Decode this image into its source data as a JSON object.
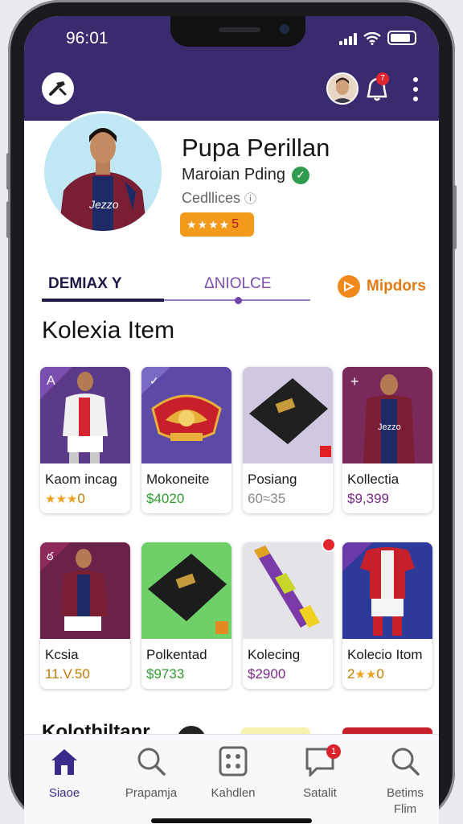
{
  "status_bar": {
    "time": "96:01"
  },
  "header": {
    "notification_count": "7"
  },
  "profile": {
    "name": "Pupa Perillan",
    "subtitle": "Maroian Pding",
    "meta": "Cedllices",
    "rating_stars": "★★★★",
    "rating_value": "5"
  },
  "tabs": [
    {
      "label": "DEMIAX Y"
    },
    {
      "label": "ΔNIOLCE"
    },
    {
      "label": "Mipdors"
    }
  ],
  "section": {
    "title": "Kolexia Item",
    "next_title": "Kolothiltanr"
  },
  "items_row1": [
    {
      "title": "Kaom incag",
      "price": "0",
      "stars": "★★★"
    },
    {
      "title": "Mokoneite",
      "price": "$4020"
    },
    {
      "title": "Posiang",
      "price": "60≈35"
    },
    {
      "title": "Kollectia",
      "price": "$9,399"
    }
  ],
  "items_row2": [
    {
      "title": "Kcsia",
      "price": "11.V.50"
    },
    {
      "title": "Polkentad",
      "price": "$9733"
    },
    {
      "title": "Kolecing",
      "price": "$2900"
    },
    {
      "title": "Kolecio Itom",
      "price": "0",
      "price_prefix": "2",
      "stars": "★★"
    }
  ],
  "bottom_nav": [
    {
      "label": "Siaoe",
      "icon": "home-icon"
    },
    {
      "label": "Prapamja",
      "icon": "search-icon"
    },
    {
      "label": "Kahdlen",
      "icon": "grid-icon"
    },
    {
      "label": "Satalit",
      "icon": "chat-icon",
      "badge": "1"
    },
    {
      "label": "Betims Flim",
      "icon": "search-icon"
    }
  ],
  "colors": {
    "header_bg": "#3a2a6e",
    "accent": "#3a2a8a",
    "rating": "#f39a1d",
    "price_green": "#2e9b2e"
  }
}
